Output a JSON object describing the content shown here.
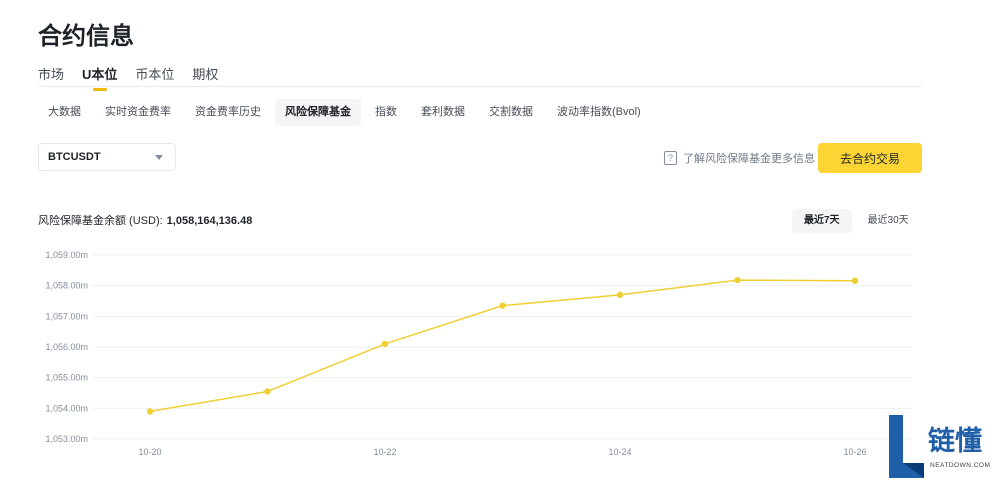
{
  "page": {
    "title": "合约信息"
  },
  "main_tabs": [
    {
      "label": "市场",
      "active": false
    },
    {
      "label": "U本位",
      "active": true
    },
    {
      "label": "币本位",
      "active": false
    },
    {
      "label": "期权",
      "active": false
    }
  ],
  "sub_tabs": [
    {
      "label": "大数据",
      "active": false
    },
    {
      "label": "实时资金费率",
      "active": false
    },
    {
      "label": "资金费率历史",
      "active": false
    },
    {
      "label": "风险保障基金",
      "active": true
    },
    {
      "label": "指数",
      "active": false
    },
    {
      "label": "套利数据",
      "active": false
    },
    {
      "label": "交割数据",
      "active": false
    },
    {
      "label": "波动率指数(Bvol)",
      "active": false
    }
  ],
  "symbol_select": {
    "value": "BTCUSDT"
  },
  "learn_more": {
    "label": "了解风险保障基金更多信息"
  },
  "trade_button": {
    "label": "去合约交易"
  },
  "balance": {
    "label": "风险保障基金余额 (USD):",
    "value": "1,058,164,136.48"
  },
  "periods": [
    {
      "label": "最近7天",
      "active": true
    },
    {
      "label": "最近30天",
      "active": false
    }
  ],
  "chart_data": {
    "type": "line",
    "x": [
      "10-20",
      "10-21",
      "10-22",
      "10-23",
      "10-24",
      "10-25",
      "10-26"
    ],
    "x_tick_labels": [
      "10-20",
      "10-22",
      "10-24",
      "10-26"
    ],
    "series": [
      {
        "values": [
          1053.9,
          1054.55,
          1056.1,
          1057.35,
          1057.7,
          1058.18,
          1058.16
        ]
      }
    ],
    "y_ticks": [
      1053,
      1054,
      1055,
      1056,
      1057,
      1058,
      1059
    ],
    "y_tick_labels": [
      "1,053.00m",
      "1,054.00m",
      "1,055.00m",
      "1,056.00m",
      "1,057.00m",
      "1,058.00m",
      "1,059.00m"
    ],
    "ylim": [
      1053,
      1059
    ],
    "grid": true,
    "colors": {
      "line": "#f0cf34",
      "grid": "#eef0f2"
    }
  },
  "watermark": {
    "char": "L",
    "name": "链懂",
    "url": "NEATDOWN.COM"
  }
}
